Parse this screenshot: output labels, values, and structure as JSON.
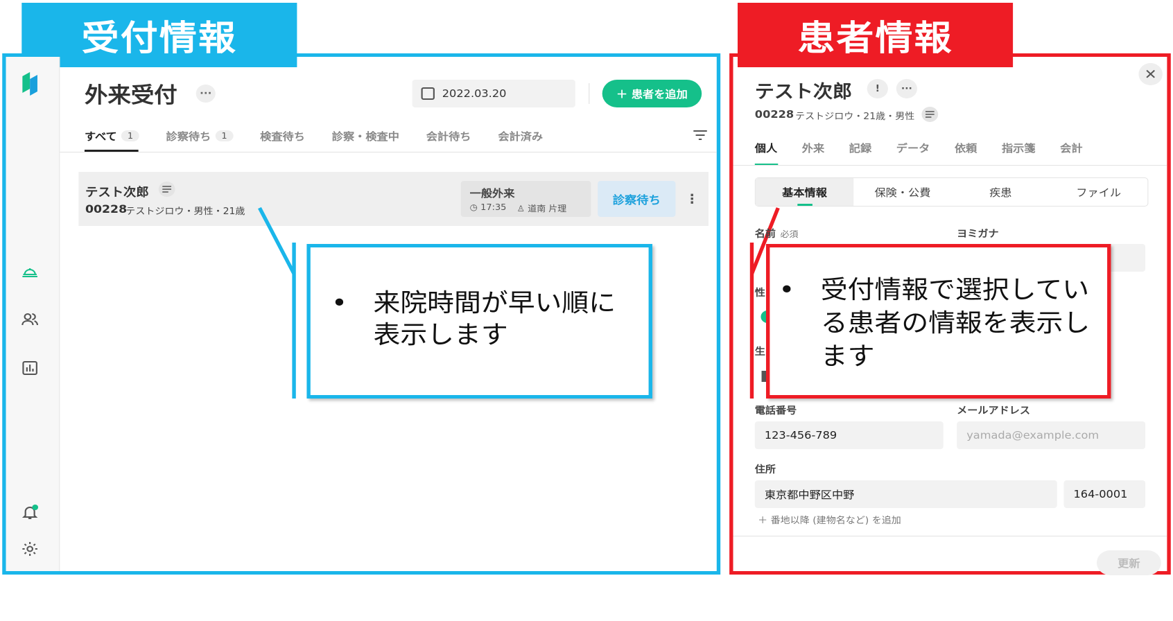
{
  "sections": {
    "reception_title": "受付情報",
    "patient_title": "患者情報"
  },
  "reception": {
    "title": "外来受付",
    "more": "···",
    "date": "2022.03.20",
    "add_patient_label": "＋ 患者を追加",
    "tabs": [
      {
        "label": "すべて",
        "count": "1"
      },
      {
        "label": "診察待ち",
        "count": "1"
      },
      {
        "label": "検査待ち",
        "count": ""
      },
      {
        "label": "診察・検査中",
        "count": ""
      },
      {
        "label": "会計待ち",
        "count": ""
      },
      {
        "label": "会計済み",
        "count": ""
      }
    ],
    "row": {
      "name": "テスト次郎",
      "id": "00228",
      "sub": "テストジロウ・男性・21歳",
      "visit_type": "一般外来",
      "time": "17:35",
      "doctor": "道南 片理",
      "status": "診察待ち"
    }
  },
  "callouts": {
    "blue_bullet": "•",
    "blue_text": "来院時間が早い順に表示します",
    "red_bullet": "•",
    "red_text": "受付情報で選択している患者の情報を表示します"
  },
  "patient": {
    "close": "✕",
    "name": "テスト次郎",
    "id": "00228",
    "sub": "テストジロウ・21歳・男性",
    "tabs": [
      "個人",
      "外来",
      "記録",
      "データ",
      "依頼",
      "指示箋",
      "会計"
    ],
    "segments": [
      "基本情報",
      "保険・公費",
      "疾患",
      "ファイル"
    ],
    "fields": {
      "name_label": "名前",
      "required": "必須",
      "kana_label": "ヨミガナ",
      "sex_label_partial": "性",
      "birth_label_partial": "生",
      "phone_label": "電話番号",
      "phone_value": "123-456-789",
      "email_label": "メールアドレス",
      "email_placeholder": "yamada@example.com",
      "address_label": "住所",
      "address_value": "東京都中野区中野",
      "zip_value": "164-0001",
      "add_address": "＋ 番地以降 (建物名など) を追加"
    },
    "update_label": "更新"
  },
  "colors": {
    "blue": "#1ab6ea",
    "red": "#ee1c25",
    "green": "#15c08a"
  }
}
